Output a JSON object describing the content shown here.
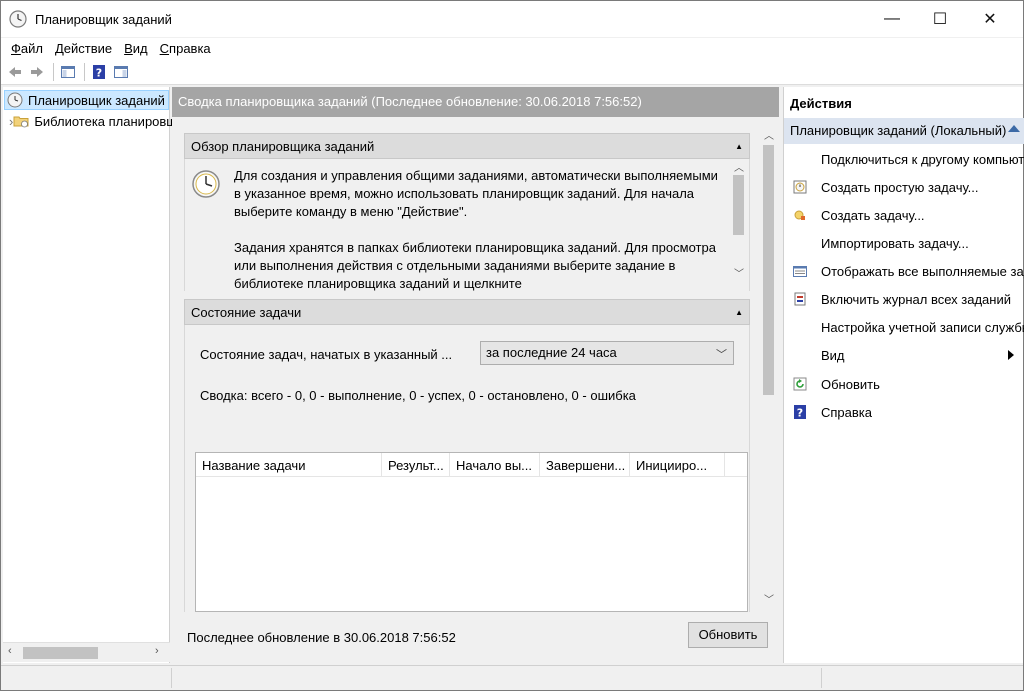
{
  "window": {
    "title": "Планировщик заданий",
    "controls": {
      "minimize": "—",
      "maximize": "☐",
      "close": "✕"
    }
  },
  "menu": {
    "items": [
      {
        "u": "Ф",
        "rest": "айл"
      },
      {
        "u": "Д",
        "rest": "ействие"
      },
      {
        "u": "В",
        "rest": "ид"
      },
      {
        "u": "С",
        "rest": "правка"
      }
    ]
  },
  "toolbar": {
    "icons": [
      "back-arrow-icon",
      "forward-arrow-icon",
      "console-tree-icon",
      "help-icon",
      "action-pane-icon"
    ]
  },
  "tree": {
    "items": [
      {
        "label": "Планировщик заданий (Локальный)",
        "selected": true
      },
      {
        "label": "Библиотека планировщика заданий",
        "selected": false
      }
    ],
    "expander": "›"
  },
  "center": {
    "header": "Сводка планировщика заданий (Последнее обновление: 30.06.2018 7:56:52)",
    "overview": {
      "title": "Обзор планировщика заданий",
      "paragraph1": "Для создания и управления общими заданиями, автоматически выполняемыми в указанное время, можно использовать планировщик заданий. Для начала выберите команду в меню \"Действие\".",
      "paragraph2": "Задания хранятся в папках библиотеки планировщика заданий. Для просмотра или выполнения действия с отдельными заданиями выберите задание в библиотеке планировщика заданий и щелкните"
    },
    "status": {
      "title": "Состояние задачи",
      "label": "Состояние задач, начатых в указанный ...",
      "selected_period": "за последние 24 часа",
      "summary": "Сводка: всего - 0, 0 - выполнение, 0 - успех, 0 - остановлено, 0 - ошибка",
      "columns": [
        "Название задачи",
        "Результ...",
        "Начало вы...",
        "Завершени...",
        "Иницииро..."
      ]
    },
    "footer": {
      "last_update": "Последнее обновление в 30.06.2018 7:56:52",
      "refresh_button": "Обновить"
    }
  },
  "actions": {
    "title": "Действия",
    "group": "Планировщик заданий (Локальный)",
    "items": [
      {
        "label": "Подключиться к другому компьютеру...",
        "icon": "none"
      },
      {
        "label": "Создать простую задачу...",
        "icon": "simple-task-icon"
      },
      {
        "label": "Создать задачу...",
        "icon": "task-icon"
      },
      {
        "label": "Импортировать задачу...",
        "icon": "none"
      },
      {
        "label": "Отображать все выполняемые задачи",
        "icon": "running-tasks-icon"
      },
      {
        "label": "Включить журнал всех заданий",
        "icon": "journal-icon"
      },
      {
        "label": "Настройка учетной записи службы AT",
        "icon": "none"
      },
      {
        "label": "Вид",
        "icon": "none"
      },
      {
        "label": "Обновить",
        "icon": "refresh-icon"
      },
      {
        "label": "Справка",
        "icon": "help-icon"
      }
    ]
  },
  "colors": {
    "selection": "#cce8ff",
    "center_header": "#a5a5a5",
    "actions_group": "#dce4f0",
    "help_blue": "#2b3fa6"
  }
}
